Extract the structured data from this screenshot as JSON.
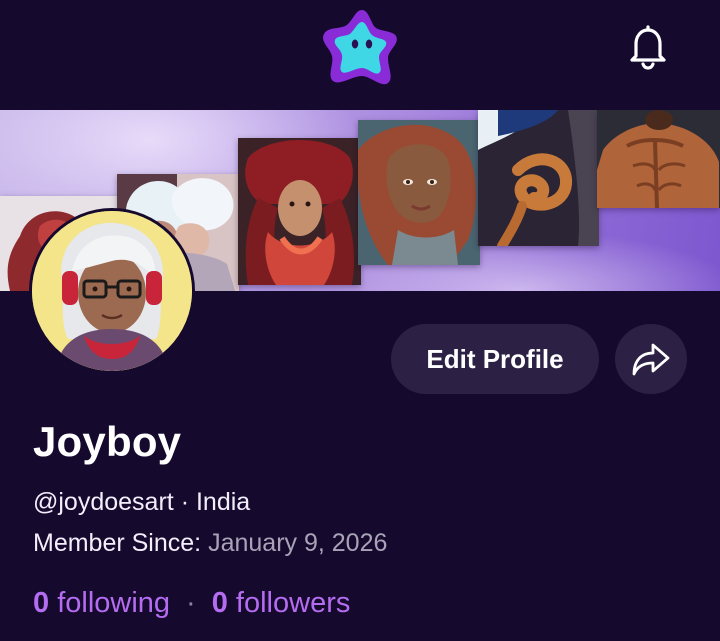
{
  "header": {
    "logo_icon": "star-logo-icon",
    "notifications_icon": "bell-icon",
    "accent_color": "#8a2bd8",
    "logo_face_color": "#3fd6e6"
  },
  "banner": {
    "artworks": [
      {
        "name": "red-haired-figure-art"
      },
      {
        "name": "white-haired-couple-art"
      },
      {
        "name": "octopus-queen-art"
      },
      {
        "name": "mermaid-portrait-art"
      },
      {
        "name": "serpent-creature-art"
      },
      {
        "name": "muscular-back-art"
      }
    ]
  },
  "profile": {
    "display_name": "Joyboy",
    "handle": "@joydoesart",
    "separator": "·",
    "location": "India",
    "member_since_label": "Member Since:",
    "member_since_date": "January 9, 2026",
    "following_count": "0",
    "following_label": "following",
    "followers_count": "0",
    "followers_label": "followers",
    "stat_separator": "·"
  },
  "actions": {
    "edit_profile_label": "Edit Profile",
    "share_icon": "share-arrow-icon"
  },
  "colors": {
    "background": "#150a2e",
    "button_bg": "#2c2145",
    "stat_accent": "#b46cf0",
    "avatar_bg": "#f4e48a"
  }
}
